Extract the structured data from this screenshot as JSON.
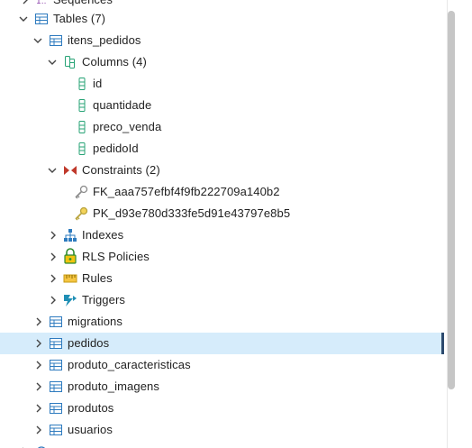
{
  "tree": {
    "sequences_label": "Sequences",
    "tables_label": "Tables (7)",
    "itens_pedidos": {
      "label": "itens_pedidos",
      "columns_label": "Columns (4)",
      "columns": [
        "id",
        "quantidade",
        "preco_venda",
        "pedidoId"
      ],
      "constraints_label": "Constraints (2)",
      "constraints": [
        "FK_aaa757efbf4f9fb222709a140b2",
        "PK_d93e780d333fe5d91e43797e8b5"
      ],
      "indexes_label": "Indexes",
      "rls_label": "RLS Policies",
      "rules_label": "Rules",
      "triggers_label": "Triggers"
    },
    "tables": [
      "migrations",
      "pedidos",
      "produto_caracteristicas",
      "produto_imagens",
      "produtos",
      "usuarios"
    ],
    "selected_table": "pedidos"
  },
  "colors": {
    "table_icon": "#2e7bbf",
    "column_icon": "#27a376",
    "constraint_icon": "#c0392b",
    "key_icon": "#b9a33b",
    "fk_icon": "#8a8a8a",
    "selected_bg": "#d6ecfb"
  }
}
